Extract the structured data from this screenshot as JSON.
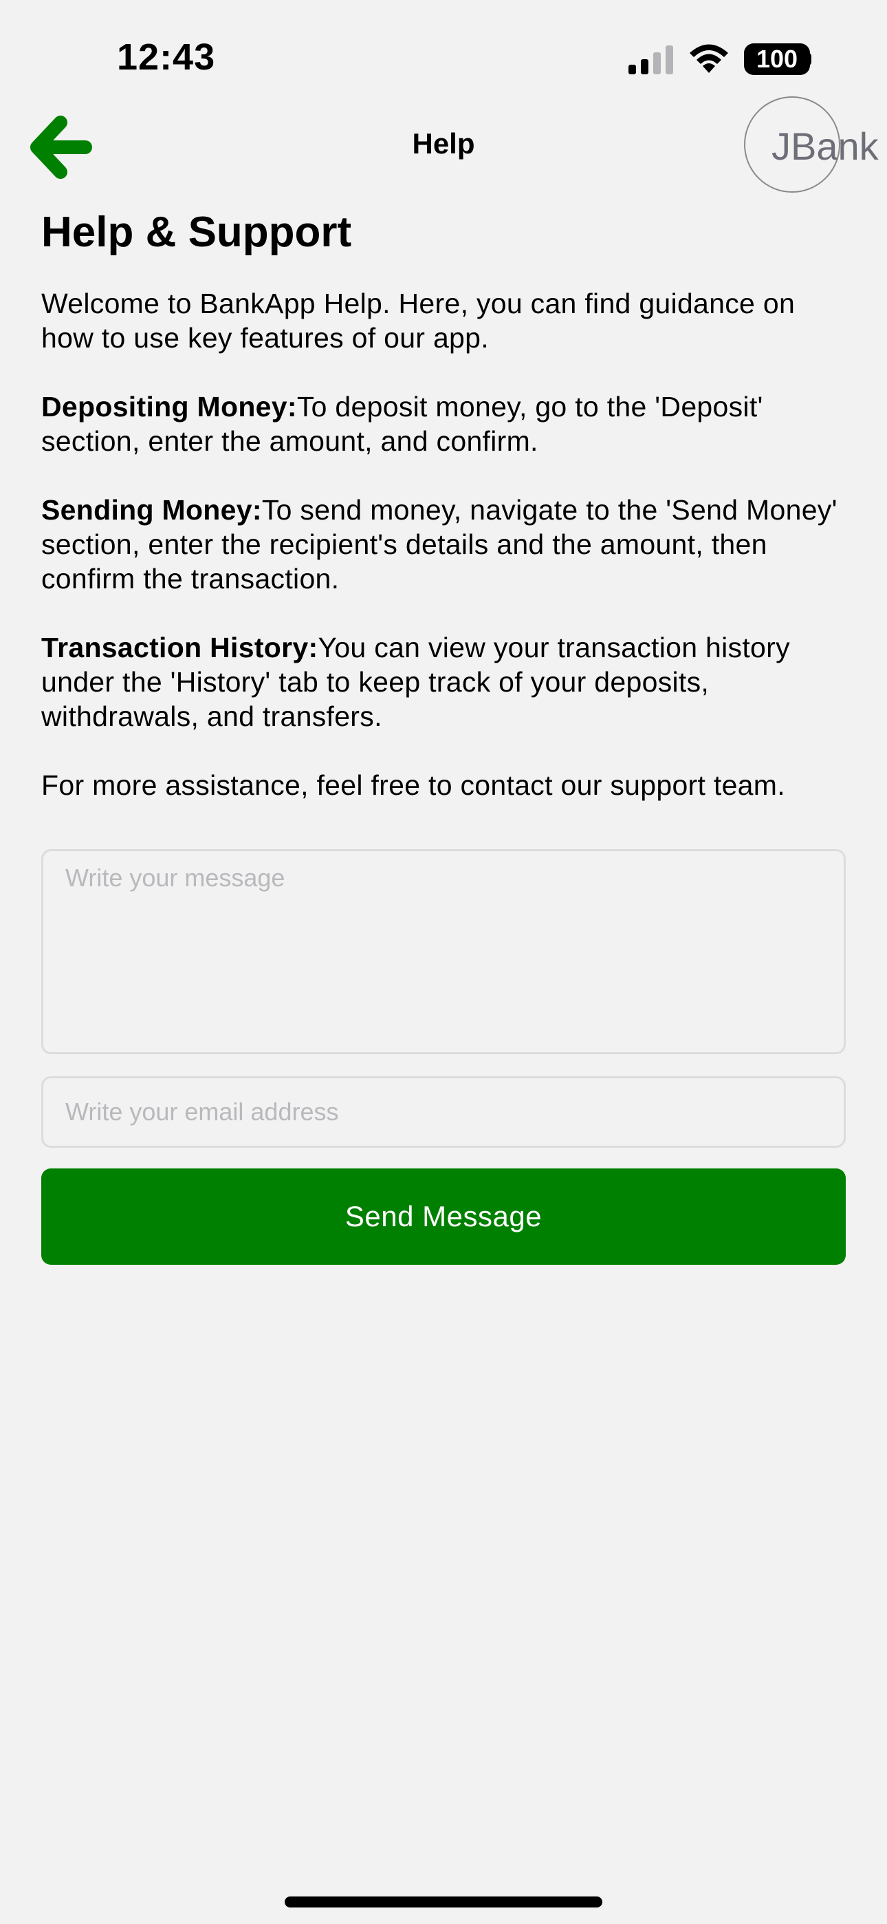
{
  "status_bar": {
    "time": "12:43",
    "battery": "100"
  },
  "nav": {
    "title": "Help",
    "logo_text": "JBank",
    "back_icon": "arrow-left-icon",
    "accent_color": "#008000"
  },
  "content": {
    "title": "Help & Support",
    "intro": "Welcome to BankApp Help. Here, you can find guidance on how to use key features of our app.",
    "sections": [
      {
        "heading": "Depositing Money:",
        "body": "To deposit money, go to the 'Deposit' section, enter the amount, and confirm."
      },
      {
        "heading": "Sending Money:",
        "body": "To send money, navigate to the 'Send Money' section, enter the recipient's details and the amount, then confirm the transaction."
      },
      {
        "heading": "Transaction History:",
        "body": "You can view your transaction history under the 'History' tab to keep track of your deposits, withdrawals, and transfers."
      }
    ],
    "outro": "For more assistance, feel free to contact our support team."
  },
  "form": {
    "message_placeholder": "Write your message",
    "message_value": "",
    "email_placeholder": "Write your email address",
    "email_value": "",
    "send_label": "Send Message"
  }
}
